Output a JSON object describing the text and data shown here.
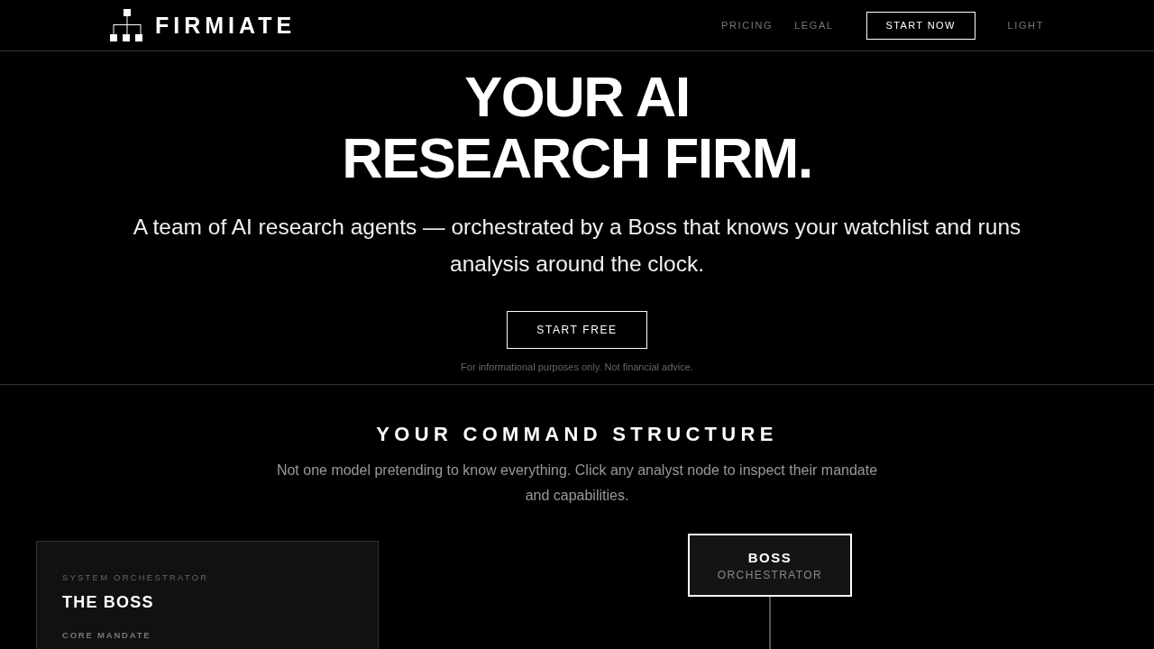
{
  "header": {
    "logo": {
      "name": "FIRMIATE"
    },
    "nav": [
      {
        "label": "PRICING",
        "kind": "link"
      },
      {
        "label": "LEGAL",
        "kind": "link"
      },
      {
        "label": "START NOW",
        "kind": "button"
      },
      {
        "label": "LIGHT",
        "kind": "link"
      }
    ]
  },
  "hero": {
    "title": "YOUR AI RESEARCH FIRM.",
    "subtitle": "A team of AI research agents — orchestrated by a Boss that knows your watchlist and runs analysis around the clock.",
    "cta": "START FREE",
    "disclaimer": "For informational purposes only. Not financial advice."
  },
  "command_structure": {
    "title": "YOUR COMMAND STRUCTURE",
    "description": "Not one model pretending to know everything. Click any analyst node to inspect their mandate and capabilities.",
    "detail_card": {
      "eyebrow": "SYSTEM ORCHESTRATOR",
      "title": "THE BOSS",
      "section_label": "CORE MANDATE"
    },
    "org_chart": {
      "nodes": [
        {
          "title": "BOSS",
          "role": "ORCHESTRATOR",
          "selected": true
        }
      ]
    }
  }
}
